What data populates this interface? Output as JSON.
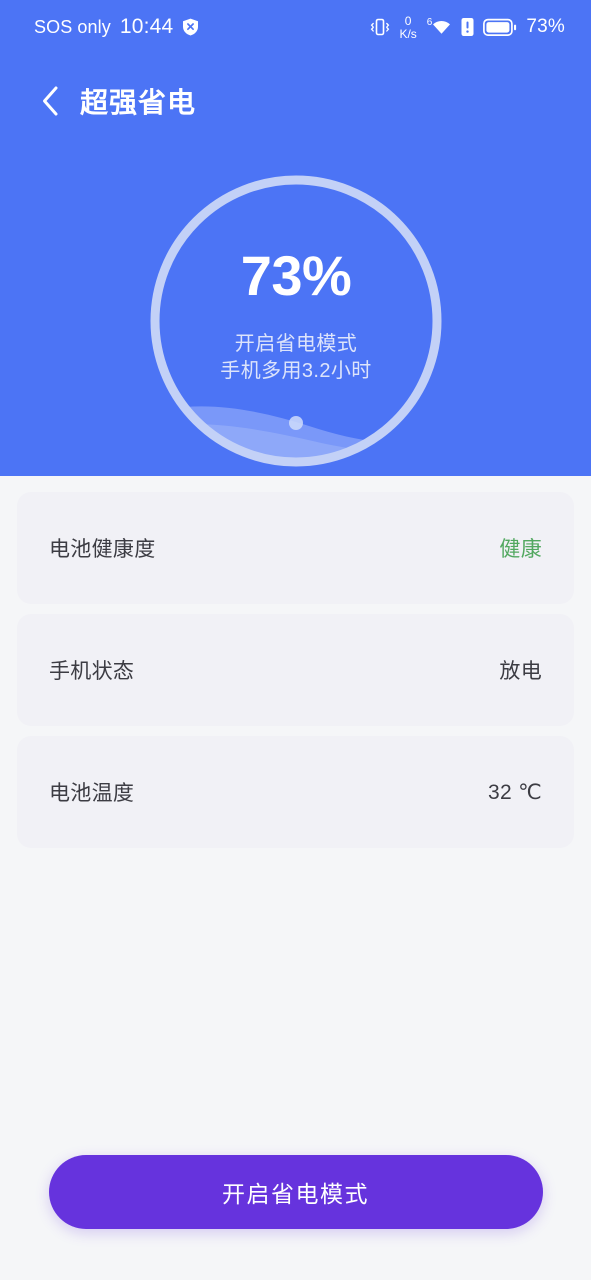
{
  "statusbar": {
    "carrier": "SOS only",
    "time": "10:44",
    "shield_icon": "shield-x-icon",
    "vibrate_icon": "vibrate-icon",
    "network_speed_value": "0",
    "network_speed_unit": "K/s",
    "wifi_generation": "6",
    "wifi_icon": "wifi-icon",
    "alert_icon": "alert-exclamation-icon",
    "battery_icon": "battery-icon",
    "battery_percent": "73%"
  },
  "header": {
    "back_icon": "chevron-left-icon",
    "title": "超强省电",
    "background_color": "#4c74f5"
  },
  "battery_gauge": {
    "percent_label": "73%",
    "percent_value": 73,
    "subtitle_line1": "开启省电模式",
    "subtitle_line2": "手机多用3.2小时",
    "ring_color": "#c3d1f7",
    "wave_color": "#7e9bf8"
  },
  "info_rows": [
    {
      "label": "电池健康度",
      "value": "健康",
      "value_color": "#52a860"
    },
    {
      "label": "手机状态",
      "value": "放电",
      "value_color": "#3c3c43"
    },
    {
      "label": "电池温度",
      "value": "32 ℃",
      "value_color": "#3c3c43"
    }
  ],
  "cta": {
    "label": "开启省电模式",
    "color": "#6633dd"
  }
}
